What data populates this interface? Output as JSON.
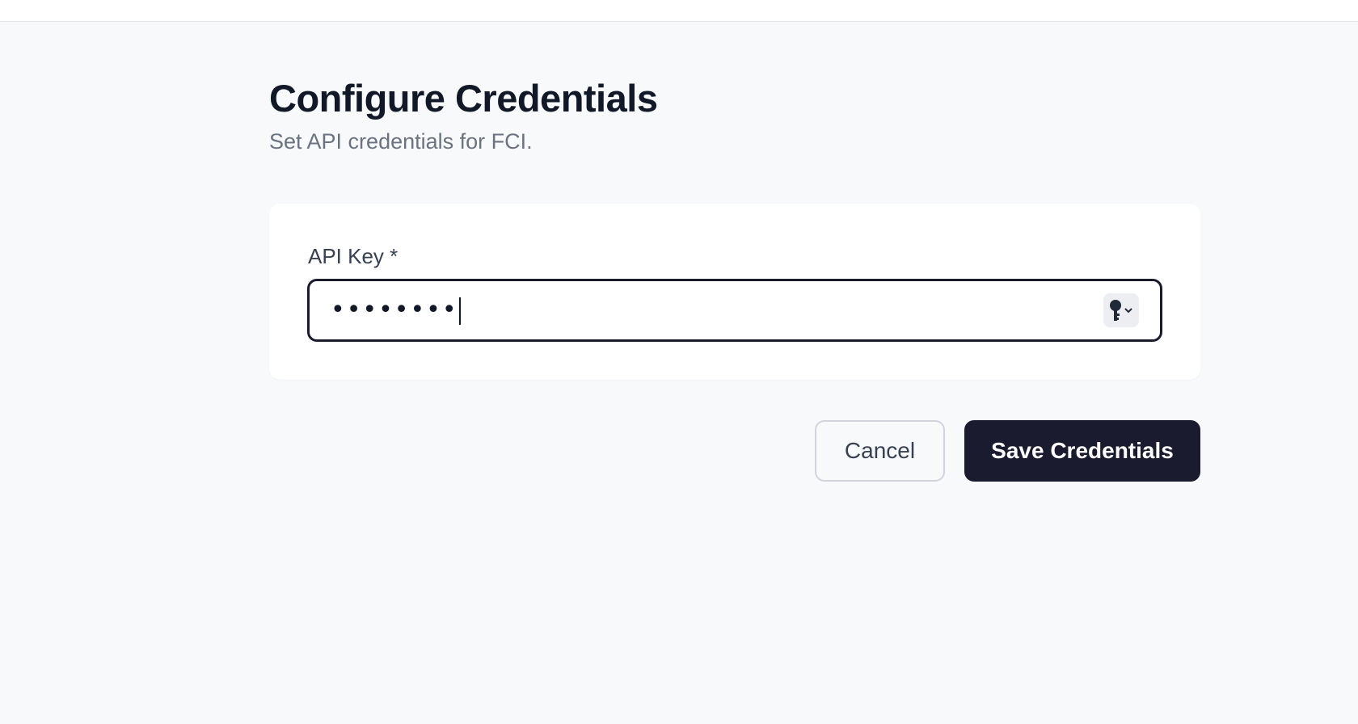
{
  "header": {
    "title": "Configure Credentials",
    "subtitle": "Set API credentials for FCI."
  },
  "form": {
    "api_key": {
      "label": "API Key *",
      "value": "••••••••",
      "icon": "key-icon"
    }
  },
  "actions": {
    "cancel_label": "Cancel",
    "save_label": "Save Credentials"
  },
  "colors": {
    "primary": "#1a1b2e",
    "background": "#f8f9fb",
    "muted_text": "#6b7280"
  }
}
